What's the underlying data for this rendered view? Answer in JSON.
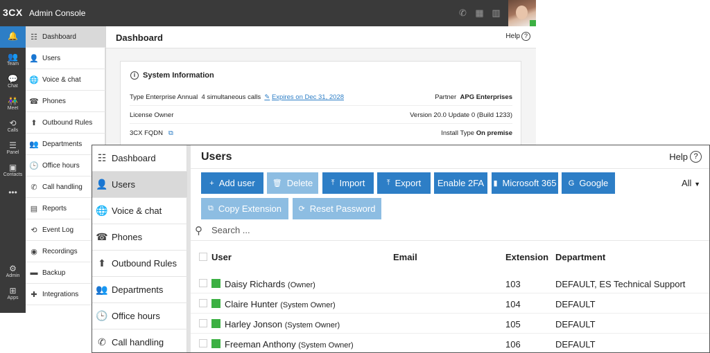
{
  "app": {
    "logo": "3CX",
    "title": "Admin Console"
  },
  "topbar_icons": [
    "phone-icon",
    "qr-code-icon",
    "book-icon"
  ],
  "rail": [
    {
      "id": "notifications",
      "label": "",
      "icon": "bell-icon",
      "glyph": "🔔",
      "active": true
    },
    {
      "id": "team",
      "label": "Team",
      "icon": "team-icon",
      "glyph": "👥"
    },
    {
      "id": "chat",
      "label": "Chat",
      "icon": "chat-icon",
      "glyph": "💬"
    },
    {
      "id": "meet",
      "label": "Meet",
      "icon": "meet-icon",
      "glyph": "👫"
    },
    {
      "id": "calls",
      "label": "Calls",
      "icon": "history-icon",
      "glyph": "⟲"
    },
    {
      "id": "panel",
      "label": "Panel",
      "icon": "panel-icon",
      "glyph": "☰"
    },
    {
      "id": "contacts",
      "label": "Contacts",
      "icon": "contacts-icon",
      "glyph": "▣"
    },
    {
      "id": "more",
      "label": "",
      "icon": "more-icon",
      "glyph": "•••"
    },
    {
      "id": "admin",
      "label": "Admin",
      "icon": "gear-icon",
      "glyph": "⚙"
    },
    {
      "id": "apps",
      "label": "Apps",
      "icon": "apps-icon",
      "glyph": "⊞"
    }
  ],
  "back_sidebar": [
    {
      "label": "Dashboard",
      "icon": "dashboard-icon",
      "glyph": "☷",
      "active": true
    },
    {
      "label": "Users",
      "icon": "user-icon",
      "glyph": "👤"
    },
    {
      "label": "Voice & chat",
      "icon": "globe-icon",
      "glyph": "🌐"
    },
    {
      "label": "Phones",
      "icon": "phones-icon",
      "glyph": "☎"
    },
    {
      "label": "Outbound Rules",
      "icon": "arrow-up-icon",
      "glyph": "⬆"
    },
    {
      "label": "Departments",
      "icon": "departments-icon",
      "glyph": "👥"
    },
    {
      "label": "Office hours",
      "icon": "clock-icon",
      "glyph": "🕒"
    },
    {
      "label": "Call handling",
      "icon": "phone-icon",
      "glyph": "✆"
    },
    {
      "label": "Reports",
      "icon": "reports-icon",
      "glyph": "▤"
    },
    {
      "label": "Event Log",
      "icon": "history-icon",
      "glyph": "⟲"
    },
    {
      "label": "Recordings",
      "icon": "recordings-icon",
      "glyph": "◉"
    },
    {
      "label": "Backup",
      "icon": "backup-icon",
      "glyph": "▬"
    },
    {
      "label": "Integrations",
      "icon": "puzzle-icon",
      "glyph": "✚"
    }
  ],
  "dashboard": {
    "title": "Dashboard",
    "help": "Help",
    "system_info": {
      "title": "System Information",
      "type_label": "Type",
      "type_value": "Enterprise Annual",
      "calls": "4 simultaneous calls",
      "expires": "Expires on Dec 31, 2028",
      "partner_label": "Partner",
      "partner_value": "APG Enterprises",
      "license_owner_label": "License Owner",
      "version": "Version 20.0 Update 0 (Build 1233)",
      "fqdn_label": "3CX FQDN",
      "install_label": "Install Type",
      "install_value": "On premise"
    }
  },
  "front_sidebar": [
    {
      "label": "Dashboard",
      "icon": "dashboard-icon",
      "glyph": "☷"
    },
    {
      "label": "Users",
      "icon": "user-icon",
      "glyph": "👤",
      "active": true
    },
    {
      "label": "Voice & chat",
      "icon": "globe-icon",
      "glyph": "🌐"
    },
    {
      "label": "Phones",
      "icon": "phones-icon",
      "glyph": "☎"
    },
    {
      "label": "Outbound Rules",
      "icon": "arrow-up-icon",
      "glyph": "⬆"
    },
    {
      "label": "Departments",
      "icon": "departments-icon",
      "glyph": "👥"
    },
    {
      "label": "Office hours",
      "icon": "clock-icon",
      "glyph": "🕒"
    },
    {
      "label": "Call handling",
      "icon": "phone-icon",
      "glyph": "✆"
    }
  ],
  "users": {
    "title": "Users",
    "help": "Help",
    "buttons_row1": [
      {
        "id": "add-user",
        "label": "Add user",
        "glyph": "+",
        "icon": "plus-icon",
        "disabled": false
      },
      {
        "id": "delete",
        "label": "Delete",
        "glyph": "🗑",
        "icon": "trash-icon",
        "disabled": true
      },
      {
        "id": "import",
        "label": "Import",
        "glyph": "⤒",
        "icon": "import-icon",
        "disabled": false
      },
      {
        "id": "export",
        "label": "Export",
        "glyph": "⤒",
        "icon": "export-icon",
        "disabled": false
      },
      {
        "id": "enable-2fa",
        "label": "Enable 2FA",
        "glyph": "",
        "icon": "",
        "disabled": false
      },
      {
        "id": "microsoft-365",
        "label": "Microsoft 365",
        "glyph": "▮",
        "icon": "office-icon",
        "disabled": false
      },
      {
        "id": "google",
        "label": "Google",
        "glyph": "G",
        "icon": "google-icon",
        "disabled": false
      }
    ],
    "buttons_row2": [
      {
        "id": "copy-extension",
        "label": "Copy Extension",
        "glyph": "⧉",
        "icon": "copy-icon",
        "disabled": true
      },
      {
        "id": "reset-password",
        "label": "Reset Password",
        "glyph": "⟳",
        "icon": "refresh-icon",
        "disabled": true
      }
    ],
    "filter": "All",
    "search_placeholder": "Search ...",
    "columns": {
      "user": "User",
      "email": "Email",
      "extension": "Extension",
      "department": "Department"
    },
    "rows": [
      {
        "name": "Daisy Richards",
        "role": "(Owner)",
        "email": "",
        "extension": "103",
        "department": "DEFAULT, ES Technical Support"
      },
      {
        "name": "Claire Hunter",
        "role": "(System Owner)",
        "email": "",
        "extension": "104",
        "department": "DEFAULT"
      },
      {
        "name": "Harley Jonson",
        "role": "(System Owner)",
        "email": "",
        "extension": "105",
        "department": "DEFAULT"
      },
      {
        "name": "Freeman Anthony",
        "role": "(System Owner)",
        "email": "",
        "extension": "106",
        "department": "DEFAULT"
      }
    ]
  },
  "colors": {
    "accent": "#2d7ec6",
    "accent_disabled": "#8dbde2",
    "online": "#3cb043",
    "dark": "#3a3a3a"
  }
}
